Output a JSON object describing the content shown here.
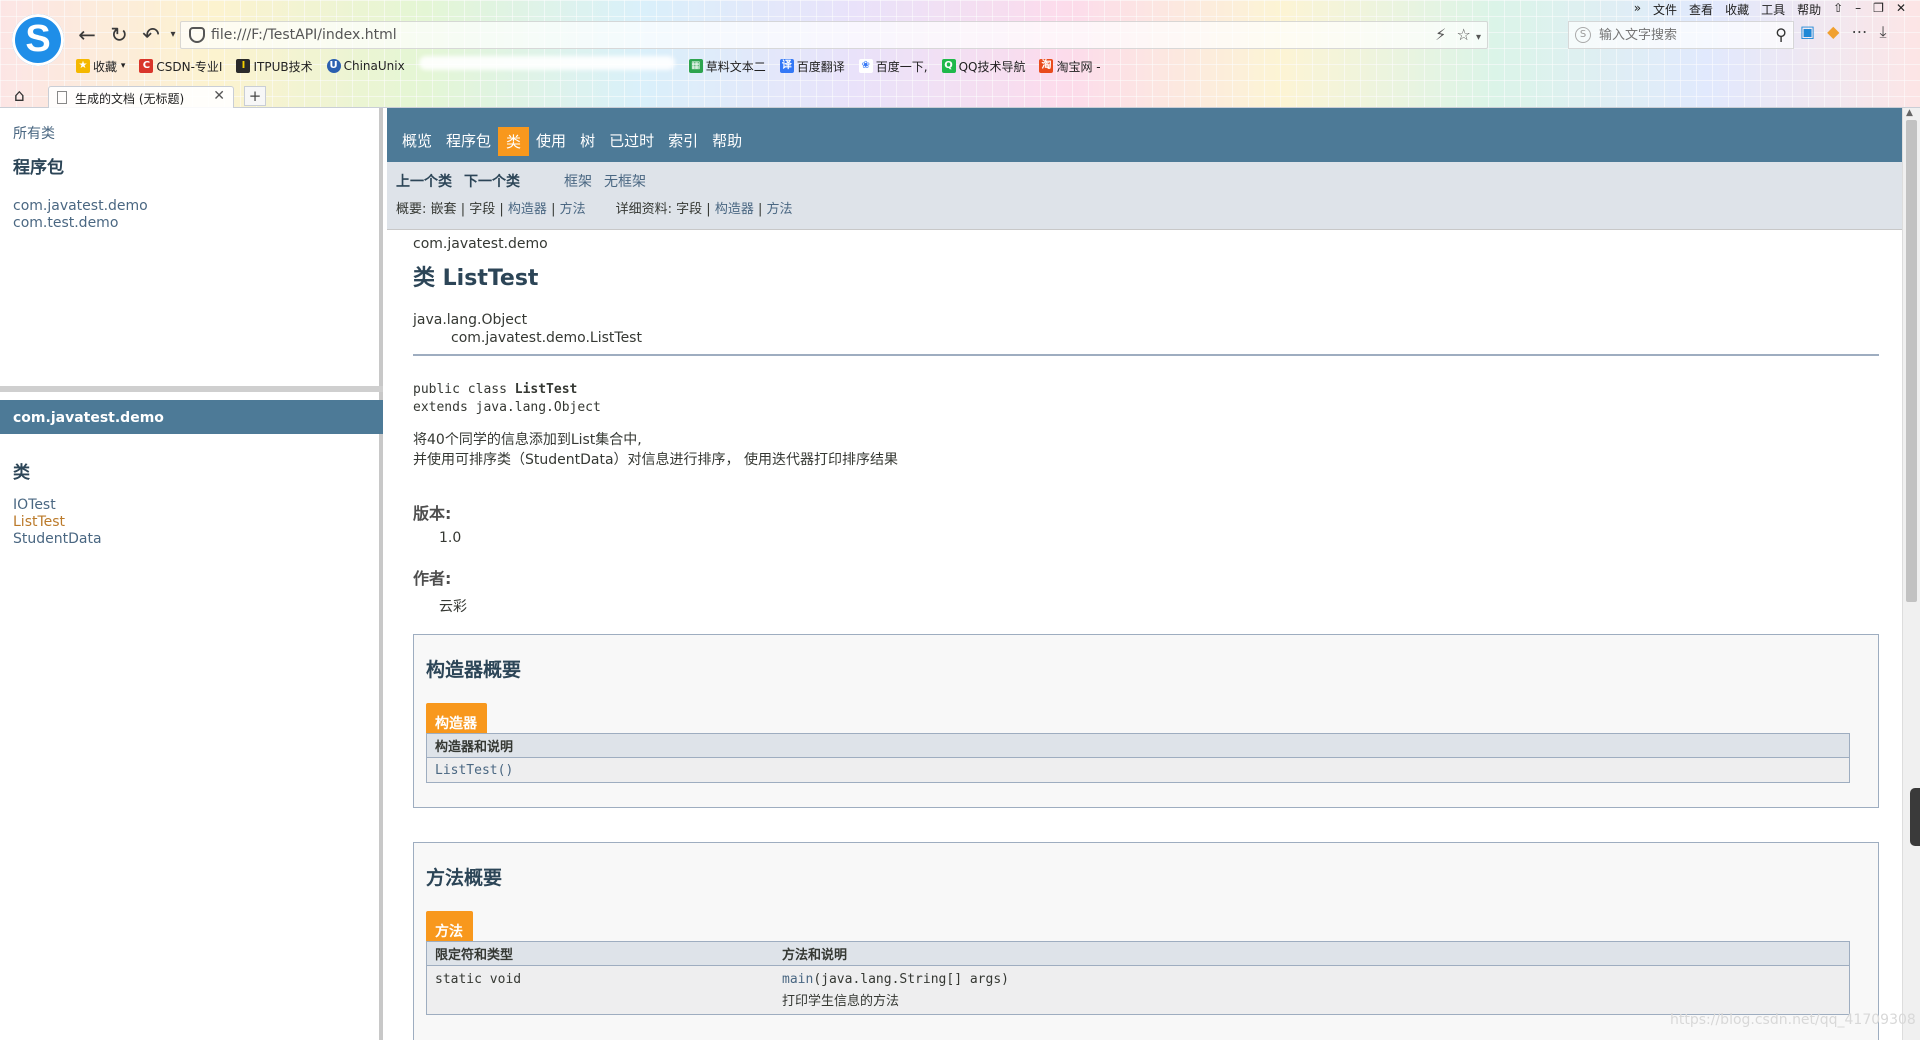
{
  "browser": {
    "url": "file:///F:/TestAPI/index.html",
    "search_placeholder": "输入文字搜索",
    "menu": [
      "»",
      "文件",
      "查看",
      "收藏",
      "工具",
      "帮助"
    ],
    "bookmarks": [
      {
        "label": "收藏",
        "color": "#f5b800"
      },
      {
        "label": "CSDN-专业I",
        "color": "#d9352a"
      },
      {
        "label": "ITPUB技术",
        "color": "#2a2a2a"
      },
      {
        "label": "ChinaUnix",
        "color": "#2b5fb0"
      },
      {
        "label": "草料文本二",
        "color": "#2da44e"
      },
      {
        "label": "百度翻译",
        "color": "#3478f6"
      },
      {
        "label": "百度一下,",
        "color": "#3478f6"
      },
      {
        "label": "QQ技术导航",
        "color": "#1fb84a"
      },
      {
        "label": "淘宝网 -",
        "color": "#e94c1d"
      }
    ],
    "tab_title": "生成的文档 (无标题)",
    "new_tab": "+"
  },
  "left": {
    "all_classes": "所有类",
    "packages_heading": "程序包",
    "packages": [
      "com.javatest.demo",
      "com.test.demo"
    ],
    "package_bar": "com.javatest.demo",
    "classes_heading": "类",
    "classes": [
      "IOTest",
      "ListTest",
      "StudentData"
    ]
  },
  "nav": {
    "items": [
      "概览",
      "程序包",
      "类",
      "使用",
      "树",
      "已过时",
      "索引",
      "帮助"
    ],
    "prev_class": "上一个类",
    "next_class": "下一个类",
    "frames": "框架",
    "no_frames": "无框架",
    "summary_label": "概要:",
    "summary_nested": "嵌套",
    "summary_field": "字段",
    "summary_constr": "构造器",
    "summary_method": "方法",
    "detail_label": "详细资料:",
    "detail_field": "字段",
    "detail_constr": "构造器",
    "detail_method": "方法",
    "sep": "|"
  },
  "doc": {
    "package": "com.javatest.demo",
    "title": "类 ListTest",
    "inherit_parent": "java.lang.Object",
    "inherit_child": "com.javatest.demo.ListTest",
    "sig_prefix": "public class ",
    "sig_name": "ListTest",
    "sig_extends": "extends java.lang.Object",
    "desc_line1": "将40个同学的信息添加到List集合中,",
    "desc_line2": "并使用可排序类（StudentData）对信息进行排序， 使用迭代器打印排序结果",
    "version_label": "版本:",
    "version": "1.0",
    "author_label": "作者:",
    "author": "云彩"
  },
  "constructor_summary": {
    "heading": "构造器概要",
    "caption": "构造器",
    "col": "构造器和说明",
    "rows": [
      "ListTest()"
    ]
  },
  "method_summary": {
    "heading": "方法概要",
    "caption": "方法",
    "col1": "限定符和类型",
    "col2": "方法和说明",
    "rows": [
      {
        "modifier": "static void",
        "name": "main",
        "params": "(java.lang.String[]  args)",
        "desc": "打印学生信息的方法"
      }
    ]
  },
  "watermark": "https://blog.csdn.net/qq_41709308",
  "colors": {
    "nav": "#4d7a97",
    "accent": "#f8981d",
    "subnav": "#dee3e9",
    "link": "#4a6782"
  }
}
